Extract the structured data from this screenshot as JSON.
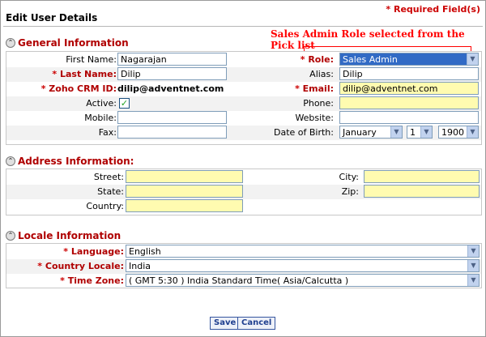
{
  "header": {
    "title": "Edit User Details",
    "required_note": "* Required Field(s)"
  },
  "annotation": {
    "text": "Sales Admin Role selected from the Pick list",
    "color": "#ff0000"
  },
  "sections": {
    "general": "General Information",
    "address": "Address Information:",
    "locale": "Locale Information"
  },
  "general": {
    "first_name_label": "First Name:",
    "first_name_value": "Nagarajan",
    "role_label": "Role:",
    "role_value": "Sales Admin",
    "last_name_label": "Last Name:",
    "last_name_value": "Dilip",
    "alias_label": "Alias:",
    "alias_value": "Dilip",
    "crm_id_label": "Zoho CRM ID:",
    "crm_id_value": "dilip@adventnet.com",
    "email_label": "Email:",
    "email_value": "dilip@adventnet.com",
    "active_label": "Active:",
    "active_checked": "✓",
    "phone_label": "Phone:",
    "phone_value": "",
    "mobile_label": "Mobile:",
    "mobile_value": "",
    "website_label": "Website:",
    "website_value": "",
    "fax_label": "Fax:",
    "fax_value": "",
    "dob_label": "Date of Birth:",
    "dob_month": "January",
    "dob_day": "1",
    "dob_year": "1900"
  },
  "address": {
    "street_label": "Street:",
    "street_value": "",
    "city_label": "City:",
    "city_value": "",
    "state_label": "State:",
    "state_value": "",
    "zip_label": "Zip:",
    "zip_value": "",
    "country_label": "Country:",
    "country_value": ""
  },
  "locale": {
    "language_label": "Language:",
    "language_value": "English",
    "country_locale_label": "Country Locale:",
    "country_locale_value": "India",
    "timezone_label": "Time Zone:",
    "timezone_value": "( GMT 5:30 ) India Standard Time( Asia/Calcutta )"
  },
  "buttons": {
    "save": "Save",
    "cancel": "Cancel"
  },
  "colors": {
    "mandatory": "#b00000",
    "highlight_field": "#fffbb0",
    "selected_option": "#316ac5"
  },
  "icons": {
    "section_toggle": "collapse-toggle-icon",
    "dropdown": "dropdown-arrow-icon",
    "checkbox": "checkmark-icon"
  }
}
